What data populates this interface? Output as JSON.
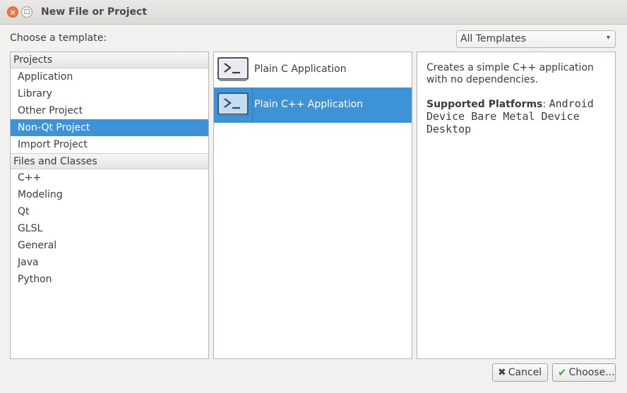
{
  "window": {
    "title": "New File or Project",
    "close_glyph": "×",
    "maximize_glyph": "□"
  },
  "chooser": {
    "label": "Choose a template:",
    "filter_value": "All Templates",
    "filter_arrow": "▾"
  },
  "categories": {
    "projects_header": "Projects",
    "projects": [
      "Application",
      "Library",
      "Other Project",
      "Non-Qt Project",
      "Import Project"
    ],
    "selected": "Non-Qt Project",
    "files_header": "Files and Classes",
    "files": [
      "C++",
      "Modeling",
      "Qt",
      "GLSL",
      "General",
      "Java",
      "Python"
    ]
  },
  "templates": [
    {
      "label": "Plain C Application",
      "icon": "terminal-icon",
      "selected": false
    },
    {
      "label": "Plain C++ Application",
      "icon": "terminal-icon",
      "selected": true
    }
  ],
  "description": {
    "text": "Creates a simple C++ application with no dependencies.",
    "platforms_label": "Supported Platforms",
    "platforms_sep": ":",
    "platforms_value": "Android Device Bare Metal Device Desktop"
  },
  "buttons": {
    "cancel_icon": "✖",
    "cancel_label": "Cancel",
    "choose_icon": "✔",
    "choose_label": "Choose..."
  },
  "colors": {
    "selection": "#3d93d6",
    "close_button": "#f07746"
  }
}
